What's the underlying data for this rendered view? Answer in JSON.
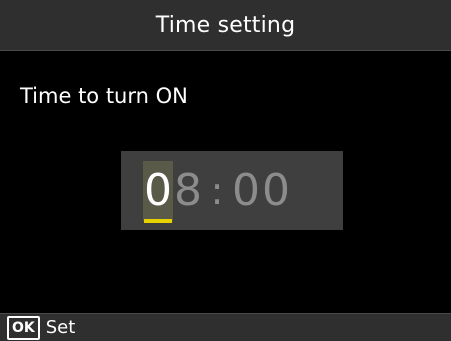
{
  "header": {
    "title": "Time setting"
  },
  "main": {
    "prompt": "Time to turn ON",
    "time": {
      "hour_tens": "0",
      "hour_ones": "8",
      "separator": ":",
      "minute_tens": "0",
      "minute_ones": "0",
      "active_digit": "hour_tens"
    }
  },
  "footer": {
    "ok_key_label": "OK",
    "action_label": "Set"
  },
  "colors": {
    "background": "#000000",
    "bar": "#2f2f2f",
    "time_box": "#3f3f3f",
    "inactive_digit": "#8c8c8c",
    "cursor": "#e6d200"
  },
  "icons": {
    "ok_key": "ok-button-icon"
  }
}
